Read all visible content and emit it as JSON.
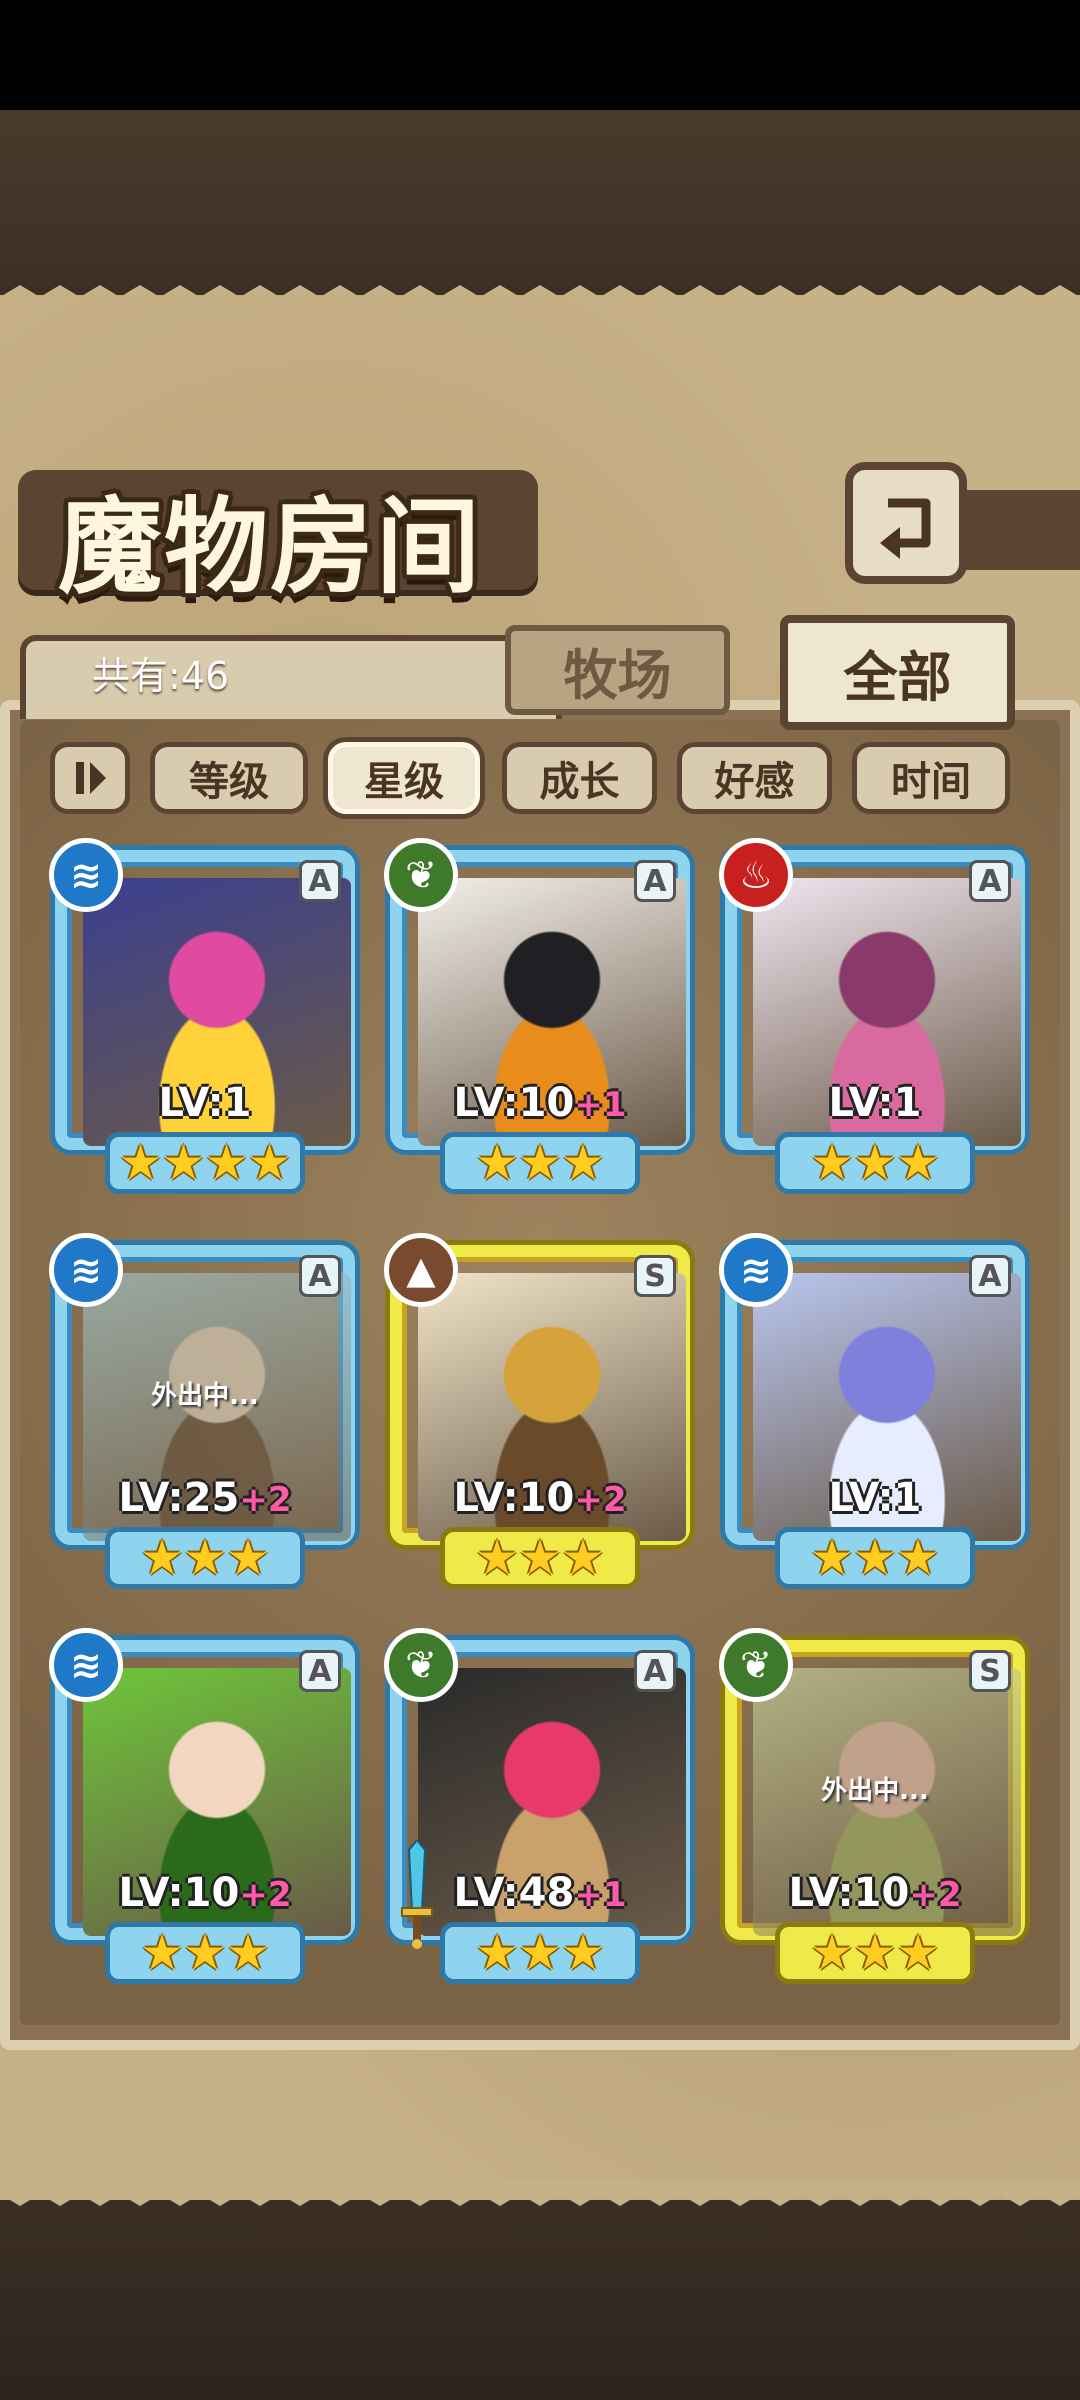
{
  "header": {
    "title": "魔物房间"
  },
  "count_label": "共有:46",
  "tabs": [
    {
      "label": "牧场",
      "active": false
    },
    {
      "label": "全部",
      "active": true
    }
  ],
  "sort_buttons": [
    {
      "label": "等级",
      "active": false
    },
    {
      "label": "星级",
      "active": true
    },
    {
      "label": "成长",
      "active": false
    },
    {
      "label": "好感",
      "active": false
    },
    {
      "label": "时间",
      "active": false
    }
  ],
  "monsters": [
    {
      "element": "water",
      "rank": "A",
      "level": "LV:1",
      "plus": "",
      "stars": "★★★★",
      "away": "",
      "frame": "blue",
      "colors": [
        "#3b3f8f",
        "#e04aa0",
        "#ffd23a"
      ]
    },
    {
      "element": "wood",
      "rank": "A",
      "level": "LV:10",
      "plus": "+1",
      "stars": "★★★",
      "away": "",
      "frame": "blue",
      "colors": [
        "#f3f0ea",
        "#1f1f24",
        "#e88c1c"
      ]
    },
    {
      "element": "fire",
      "rank": "A",
      "level": "LV:1",
      "plus": "",
      "stars": "★★★",
      "away": "",
      "frame": "blue",
      "colors": [
        "#f0e6f0",
        "#8a3a6a",
        "#d96aa0"
      ]
    },
    {
      "element": "water",
      "rank": "A",
      "level": "LV:25",
      "plus": "+2",
      "stars": "★★★",
      "away": "外出中...",
      "frame": "blue",
      "colors": [
        "#a9d8e6",
        "#e8e0d2",
        "#5a4a3a"
      ]
    },
    {
      "element": "earth",
      "rank": "S",
      "level": "LV:10",
      "plus": "+2",
      "stars": "★★★",
      "away": "",
      "frame": "gold",
      "colors": [
        "#f0e4c8",
        "#d6a23a",
        "#6a4a2a"
      ]
    },
    {
      "element": "water",
      "rank": "A",
      "level": "LV:1",
      "plus": "",
      "stars": "★★★",
      "away": "",
      "frame": "blue",
      "colors": [
        "#b9c6f0",
        "#7f7fdc",
        "#e8ecff"
      ]
    },
    {
      "element": "water",
      "rank": "A",
      "level": "LV:10",
      "plus": "+2",
      "stars": "★★★",
      "away": "",
      "frame": "blue",
      "colors": [
        "#6ec63a",
        "#f3d6c0",
        "#2a6a1a"
      ]
    },
    {
      "element": "wood",
      "rank": "A",
      "level": "LV:48",
      "plus": "+1",
      "stars": "★★★",
      "away": "",
      "frame": "blue",
      "colors": [
        "#2a2a2a",
        "#e83a6a",
        "#c8a26a"
      ]
    },
    {
      "element": "wood",
      "rank": "S",
      "level": "LV:10",
      "plus": "+2",
      "stars": "★★★",
      "away": "外出中...",
      "frame": "gold",
      "colors": [
        "#d6e8b0",
        "#f6d0c0",
        "#a8c070"
      ]
    }
  ]
}
